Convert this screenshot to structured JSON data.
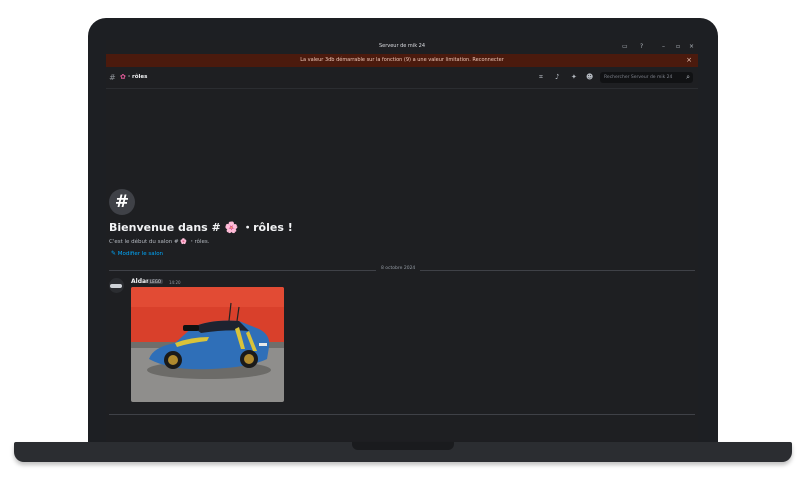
{
  "window": {
    "title": "Serveur de mik 24"
  },
  "banner": {
    "message": "La valeur 3db démarrable sur la fonction (9) a une valeur limitation.   Reconnecter",
    "close_label": "×"
  },
  "channel": {
    "name": "· rôles",
    "search_placeholder": "Rechercher Serveur de mik 24"
  },
  "welcome": {
    "icon": "#",
    "title": "Bienvenue dans # 🌸 ・rôles !",
    "subtitle": "C'est le début du salon # 🌸 ・rôles.",
    "edit_label": "Modifier le salon"
  },
  "messages": [
    {
      "date_divider": "8 octobre 2024",
      "author": "Aldan",
      "tag": "LEGO",
      "time": "14:20"
    }
  ],
  "icons": {
    "window_icon": "discord-icon",
    "inbox": "inbox-icon",
    "help": "help-icon",
    "minimize": "minimize-icon",
    "maximize": "maximize-icon",
    "close": "close-icon",
    "threads": "threads-icon",
    "notifications": "bell-icon",
    "pins": "pin-icon",
    "members": "members-icon",
    "search": "search-icon"
  },
  "colors": {
    "background": "#1e1f22",
    "banner": "#4b1a0d",
    "link": "#00a8fc",
    "accent_flower": "#e45b9a"
  }
}
